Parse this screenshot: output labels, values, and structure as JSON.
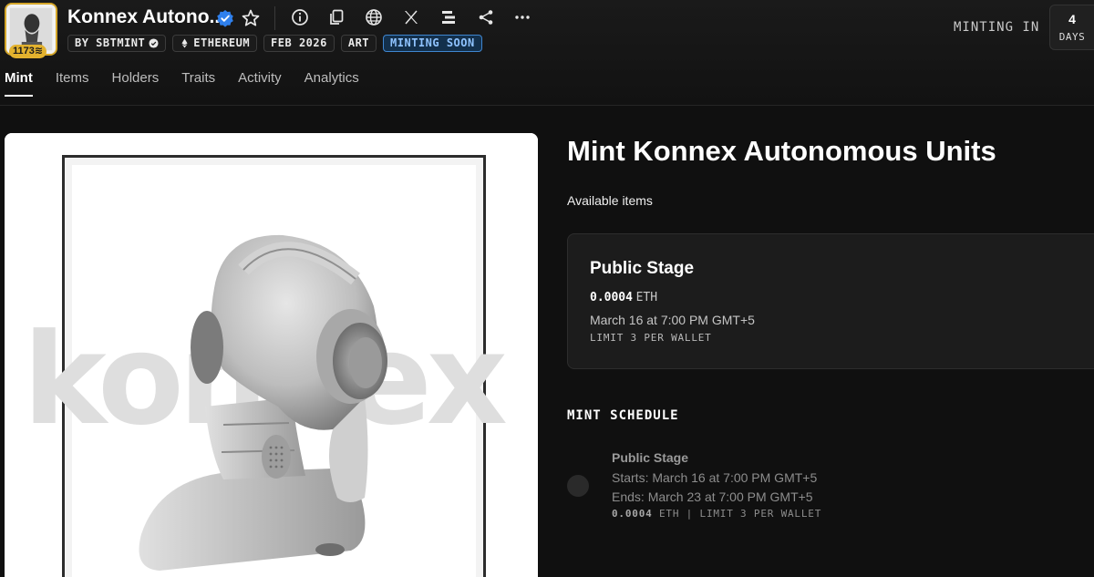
{
  "collection": {
    "title": "Konnex Autono...",
    "avatar_badge": "1173",
    "tags": [
      {
        "label": "BY SBTMINT",
        "icon": "verified-icon"
      },
      {
        "label": "ETHEREUM",
        "icon": "ethereum-icon"
      },
      {
        "label": "FEB 2026"
      },
      {
        "label": "ART"
      },
      {
        "label": "MINTING SOON"
      }
    ]
  },
  "header_icons": [
    "info-icon",
    "copy-icon",
    "globe-icon",
    "x-logo-icon",
    "stack-icon",
    "share-icon",
    "more-icon"
  ],
  "countdown": {
    "label": "MINTING IN",
    "value": "4",
    "unit": "DAYS"
  },
  "tabs": [
    "Mint",
    "Items",
    "Holders",
    "Traits",
    "Activity",
    "Analytics"
  ],
  "artwork": {
    "watermark_text": "konnex"
  },
  "mint": {
    "title": "Mint Konnex Autonomous Units",
    "available_label": "Available items",
    "stage": {
      "name": "Public Stage",
      "price": "0.0004",
      "currency": "ETH",
      "date": "March 16 at 7:00 PM GMT+5",
      "limit": "LIMIT 3 PER WALLET"
    },
    "schedule_heading": "MINT SCHEDULE",
    "schedule": {
      "name": "Public Stage",
      "starts": "Starts: March 16 at 7:00 PM GMT+5",
      "ends": "Ends: March 23 at 7:00 PM GMT+5",
      "price": "0.0004",
      "meta": "ETH | LIMIT 3 PER WALLET"
    }
  },
  "colors": {
    "background": "#101010",
    "accent_gold": "#d4a62a",
    "verified_blue": "#2f80ed",
    "minting_tag": "#3f86d0"
  }
}
